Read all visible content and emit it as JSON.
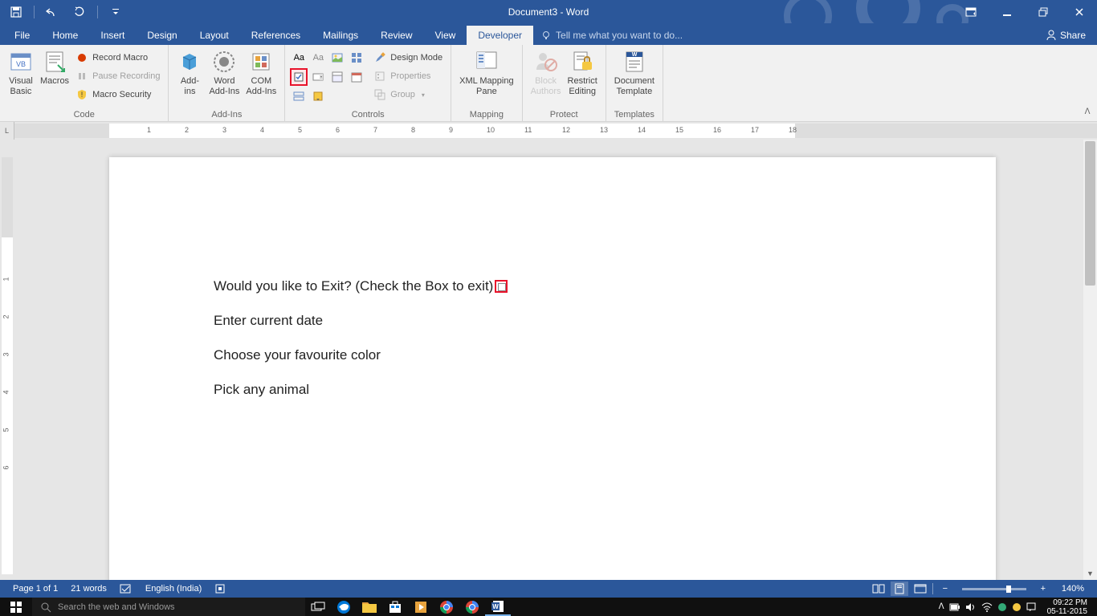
{
  "title": "Document3 - Word",
  "tabs": {
    "file": "File",
    "home": "Home",
    "insert": "Insert",
    "design": "Design",
    "layout": "Layout",
    "references": "References",
    "mailings": "Mailings",
    "review": "Review",
    "view": "View",
    "developer": "Developer"
  },
  "tellme": "Tell me what you want to do...",
  "share": "Share",
  "ribbon": {
    "code": {
      "label": "Code",
      "vb": "Visual\nBasic",
      "macros": "Macros",
      "record": "Record Macro",
      "pause": "Pause Recording",
      "security": "Macro Security"
    },
    "addins": {
      "label": "Add-Ins",
      "addins": "Add-\nins",
      "word": "Word\nAdd-Ins",
      "com": "COM\nAdd-Ins"
    },
    "controls": {
      "label": "Controls",
      "design": "Design Mode",
      "props": "Properties",
      "group": "Group"
    },
    "mapping": {
      "label": "Mapping",
      "xml": "XML Mapping\nPane"
    },
    "protect": {
      "label": "Protect",
      "block": "Block\nAuthors",
      "restrict": "Restrict\nEditing"
    },
    "templates": {
      "label": "Templates",
      "doc": "Document\nTemplate"
    }
  },
  "document": {
    "line1": "Would you like to Exit? (Check the Box to exit)",
    "line2": "Enter current date",
    "line3": "Choose your favourite color",
    "line4": "Pick any animal"
  },
  "status": {
    "page": "Page 1 of 1",
    "words": "21 words",
    "lang": "English (India)",
    "zoom": "140%"
  },
  "taskbar": {
    "search": "Search the web and Windows",
    "time": "09:22 PM",
    "date": "05-11-2015"
  }
}
